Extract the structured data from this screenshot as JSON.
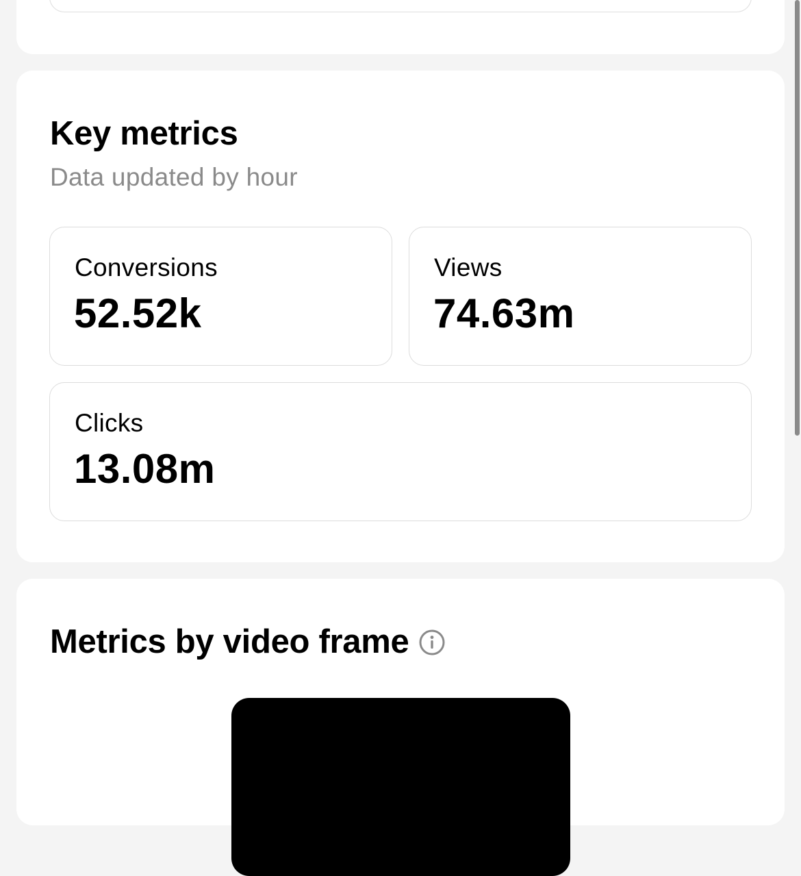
{
  "key_metrics": {
    "title": "Key metrics",
    "subtitle": "Data updated by hour",
    "metrics": [
      {
        "label": "Conversions",
        "value": "52.52k"
      },
      {
        "label": "Views",
        "value": "74.63m"
      },
      {
        "label": "Clicks",
        "value": "13.08m"
      }
    ]
  },
  "metrics_by_frame": {
    "title": "Metrics by video frame",
    "info_icon": "info-icon"
  },
  "colors": {
    "page_background": "#f4f4f4",
    "card_background": "#ffffff",
    "subtitle_text": "#8a8a8a",
    "card_border": "#dcdcdc",
    "video_frame": "#000000"
  }
}
